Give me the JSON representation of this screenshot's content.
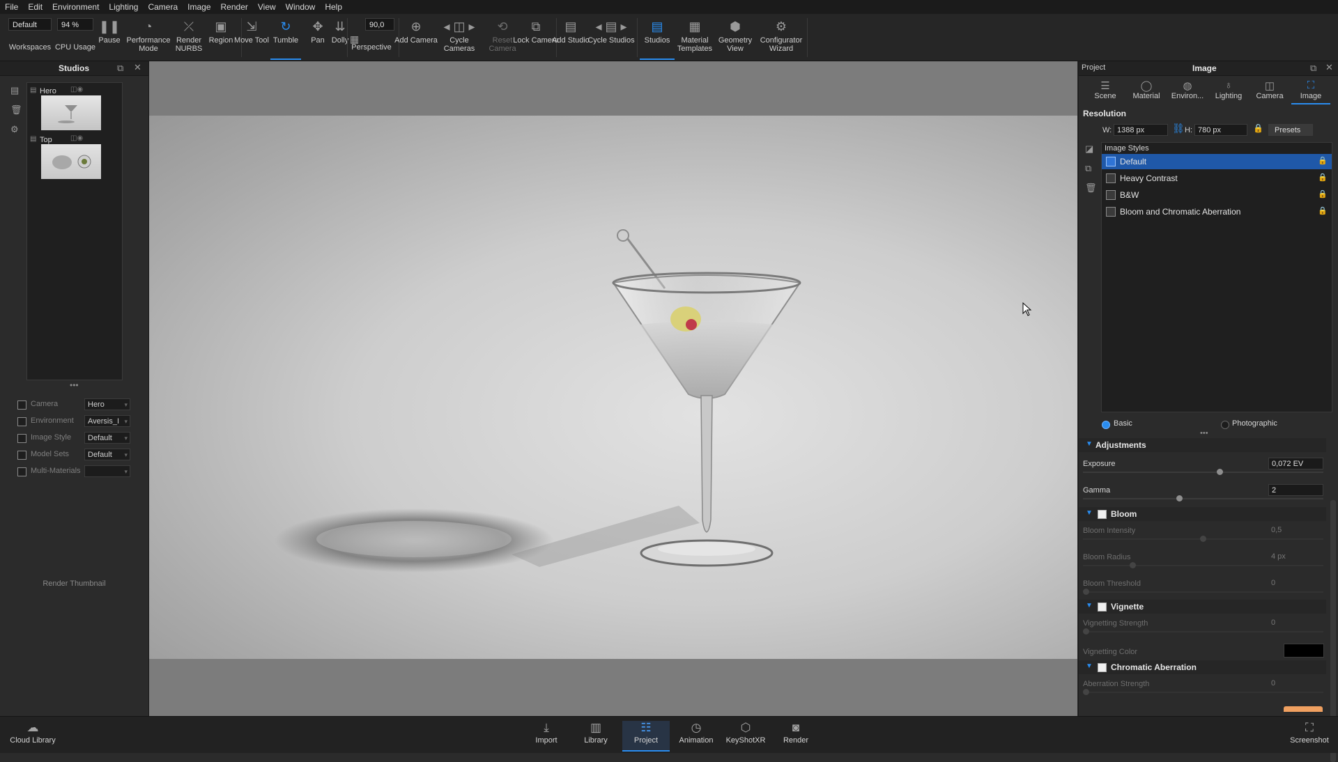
{
  "menu": [
    "File",
    "Edit",
    "Environment",
    "Lighting",
    "Camera",
    "Image",
    "Render",
    "View",
    "Window",
    "Help"
  ],
  "toolbar": {
    "workspace_value": "Default",
    "cpu_value": "94 %",
    "fov_value": "90,0",
    "items": {
      "workspaces": "Workspaces",
      "cpu_usage": "CPU Usage",
      "pause": "Pause",
      "performance_mode": "Performance Mode",
      "render_nurbs": "Render NURBS",
      "region": "Region",
      "move_tool": "Move Tool",
      "tumble": "Tumble",
      "pan": "Pan",
      "dolly": "Dolly",
      "perspective": "Perspective",
      "add_camera": "Add Camera",
      "cycle_cameras": "Cycle Cameras",
      "reset_camera": "Reset Camera",
      "lock_camera": "Lock Camera",
      "add_studio": "Add Studio",
      "cycle_studios": "Cycle Studios",
      "studios": "Studios",
      "material_templates": "Material Templates",
      "geometry_view": "Geometry View",
      "configurator_wizard": "Configurator Wizard"
    }
  },
  "left_panel": {
    "title": "Studios",
    "studios": [
      {
        "name": "Hero"
      },
      {
        "name": "Top"
      }
    ],
    "rows": [
      {
        "label": "Camera",
        "value": "Hero"
      },
      {
        "label": "Environment",
        "value": "Aversis_I"
      },
      {
        "label": "Image Style",
        "value": "Default"
      },
      {
        "label": "Model Sets",
        "value": "Default"
      },
      {
        "label": "Multi-Materials",
        "value": ""
      }
    ],
    "render_thumbnail": "Render Thumbnail"
  },
  "right_panel": {
    "left_title": "Project",
    "title": "Image",
    "tabs": [
      "Scene",
      "Material",
      "Environ...",
      "Lighting",
      "Camera",
      "Image"
    ],
    "active_tab": "Image",
    "resolution": {
      "heading": "Resolution",
      "w_label": "W:",
      "w_value": "1388 px",
      "h_label": "H:",
      "h_value": "780 px",
      "presets": "Presets"
    },
    "image_styles": {
      "heading": "Image Styles",
      "items": [
        "Default",
        "Heavy Contrast",
        "B&W",
        "Bloom and Chromatic Aberration"
      ],
      "selected": "Default"
    },
    "modes": {
      "basic": "Basic",
      "photographic": "Photographic",
      "selected": "Basic"
    },
    "adjustments": {
      "heading": "Adjustments",
      "exposure_label": "Exposure",
      "exposure_value": "0,072 EV",
      "exposure_level": 0.57,
      "gamma_label": "Gamma",
      "gamma_value": "2",
      "gamma_level": 0.4
    },
    "bloom": {
      "heading": "Bloom",
      "intensity_label": "Bloom Intensity",
      "intensity_value": "0,5",
      "intensity_level": 0.5,
      "radius_label": "Bloom Radius",
      "radius_value": "4 px",
      "radius_level": 0.2,
      "threshold_label": "Bloom Threshold",
      "threshold_value": "0",
      "threshold_level": 0.0
    },
    "vignette": {
      "heading": "Vignette",
      "strength_label": "Vignetting Strength",
      "strength_value": "0",
      "strength_level": 0.0,
      "color_label": "Vignetting Color",
      "color": "#000000"
    },
    "chromatic": {
      "heading": "Chromatic Aberration",
      "strength_label": "Aberration Strength",
      "strength_value": "0",
      "strength_level": 0.0,
      "swatch_color": "#f0a060"
    }
  },
  "bottombar": {
    "cloud_library": "Cloud Library",
    "import": "Import",
    "library": "Library",
    "project": "Project",
    "animation": "Animation",
    "keyshotxr": "KeyShotXR",
    "render": "Render",
    "screenshot": "Screenshot",
    "active": "Project"
  },
  "colors": {
    "accent": "#2a8df0",
    "selection": "#1f58a8"
  }
}
